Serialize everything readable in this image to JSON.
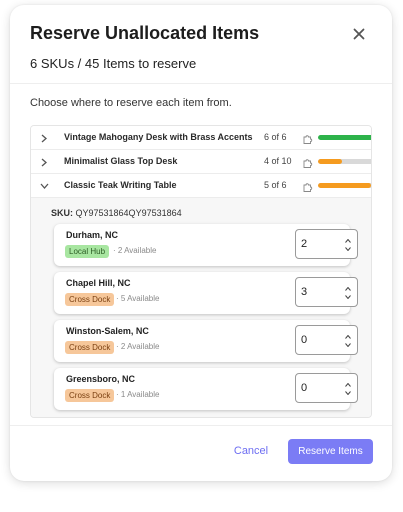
{
  "dialog": {
    "title": "Reserve Unallocated Items",
    "summary": "6 SKUs / 45 Items to reserve",
    "instruction": "Choose where to reserve each item from.",
    "cancel_label": "Cancel",
    "reserve_label": "Reserve Items"
  },
  "items": [
    {
      "name": "Vintage Mahogany Desk with Brass Accents",
      "count": "6 of 6",
      "progress": 1.0,
      "bar_color": "#2db34a",
      "expanded": false
    },
    {
      "name": "Minimalist Glass Top Desk",
      "count": "4 of 10",
      "progress": 0.4,
      "bar_color": "#f59b1f",
      "expanded": false
    },
    {
      "name": "Classic Teak Writing Table",
      "count": "5 of 6",
      "progress": 0.9,
      "bar_color": "#f59b1f",
      "expanded": true
    }
  ],
  "sku": {
    "label": "SKU:",
    "value": "QY97531864QY97531864"
  },
  "locations": [
    {
      "city": "Durham, NC",
      "tag": "Local Hub",
      "tag_type": "hub",
      "available": "· 2 Available",
      "quantity": "2"
    },
    {
      "city": "Chapel Hill, NC",
      "tag": "Cross Dock",
      "tag_type": "dock",
      "available": "· 5 Available",
      "quantity": "3"
    },
    {
      "city": "Winston-Salem, NC",
      "tag": "Cross Dock",
      "tag_type": "dock",
      "available": "· 2 Available",
      "quantity": "0"
    },
    {
      "city": "Greensboro, NC",
      "tag": "Cross Dock",
      "tag_type": "dock",
      "available": "· 1 Available",
      "quantity": "0"
    }
  ],
  "colors": {
    "accent": "#7b7cf5",
    "link": "#6d6ef2",
    "complete": "#2db34a",
    "partial": "#f59b1f"
  }
}
